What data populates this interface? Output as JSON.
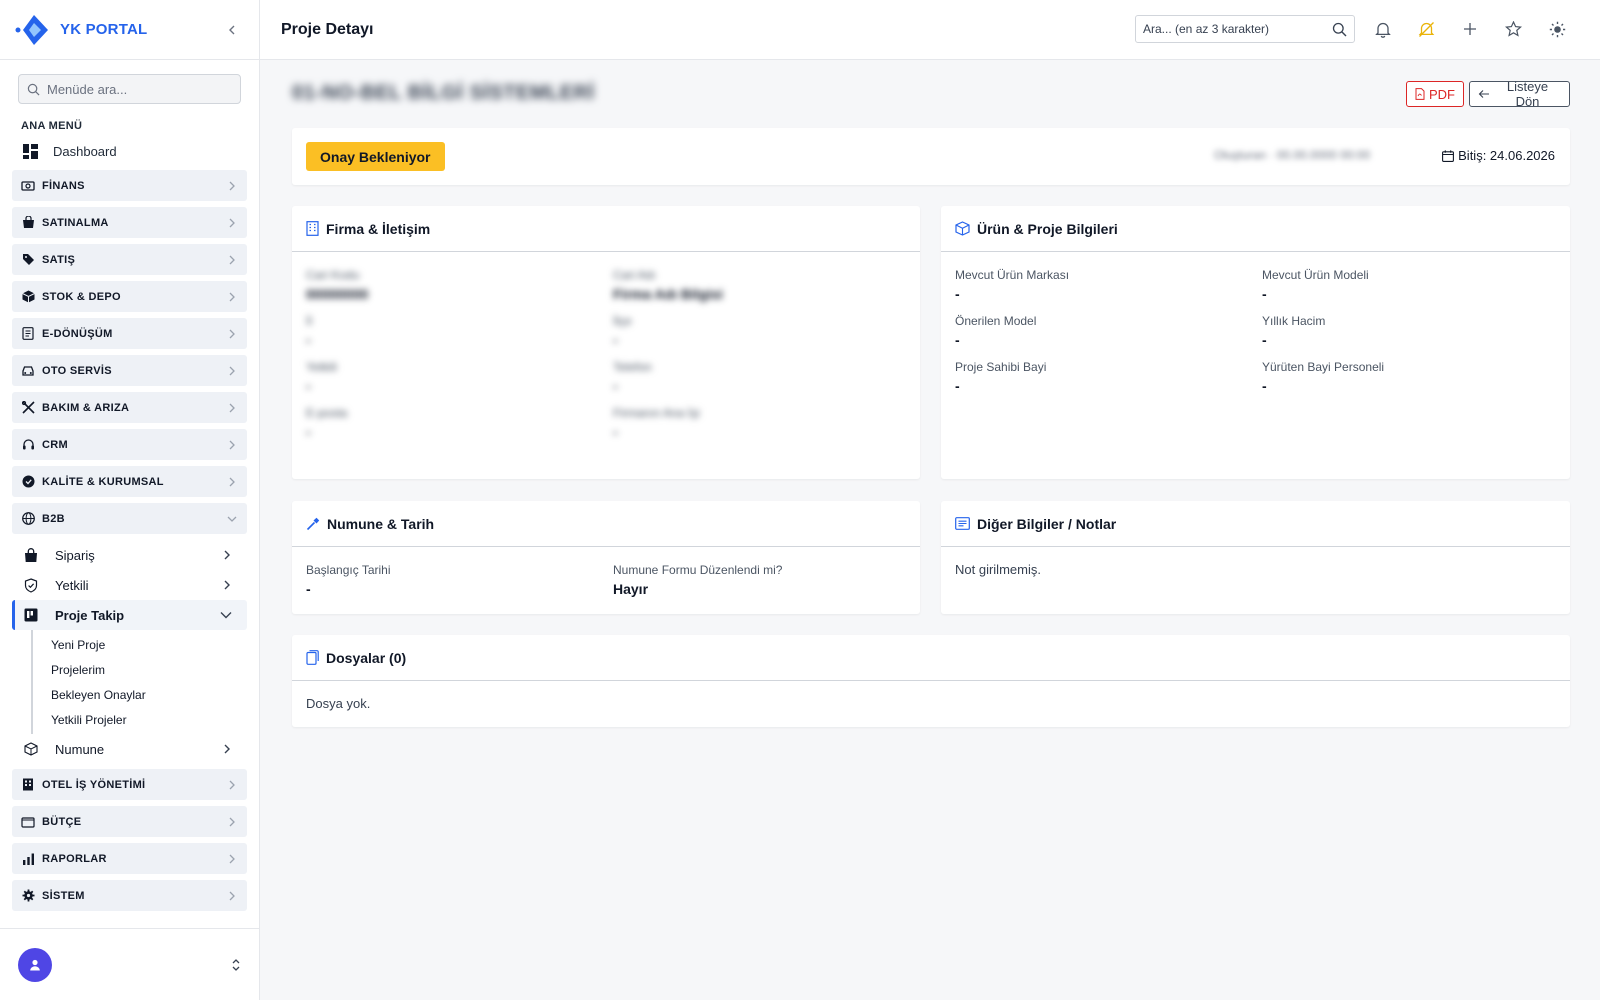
{
  "brand": {
    "name": "YK PORTAL"
  },
  "sidebar": {
    "search_placeholder": "Menüde ara...",
    "section_title": "ANA MENÜ",
    "dashboard_label": "Dashboard",
    "groups_top": [
      {
        "label": "FİNANS",
        "icon": "finance-icon"
      },
      {
        "label": "SATINALMA",
        "icon": "shopping-bag-icon"
      },
      {
        "label": "SATIŞ",
        "icon": "tag-icon"
      },
      {
        "label": "STOK & DEPO",
        "icon": "box-icon"
      },
      {
        "label": "E-DÖNÜŞÜM",
        "icon": "document-icon"
      },
      {
        "label": "OTO SERVİS",
        "icon": "car-icon"
      },
      {
        "label": "BAKIM & ARIZA",
        "icon": "tools-icon"
      },
      {
        "label": "CRM",
        "icon": "headset-icon"
      },
      {
        "label": "KALİTE & KURUMSAL",
        "icon": "badge-check-icon"
      },
      {
        "label": "B2B",
        "icon": "globe-icon"
      }
    ],
    "b2b_items": [
      {
        "label": "Sipariş",
        "icon": "bag-icon"
      },
      {
        "label": "Yetkili",
        "icon": "shield-icon"
      },
      {
        "label": "Proje Takip",
        "icon": "kanban-icon"
      }
    ],
    "proje_takip_items": [
      "Yeni Proje",
      "Projelerim",
      "Bekleyen Onaylar",
      "Yetkili Projeler"
    ],
    "numune_label": "Numune",
    "groups_bottom": [
      {
        "label": "OTEL İŞ YÖNETİMİ",
        "icon": "building-icon"
      },
      {
        "label": "BÜTÇE",
        "icon": "wallet-icon"
      },
      {
        "label": "RAPORLAR",
        "icon": "bar-chart-icon"
      },
      {
        "label": "SİSTEM",
        "icon": "gear-icon"
      }
    ]
  },
  "topbar": {
    "page_title": "Proje Detayı",
    "search_placeholder": "Ara... (en az 3 karakter)"
  },
  "header": {
    "project_title": "01-NO-BEL BİLGİ SİSTEMLERİ",
    "pdf_label": "PDF",
    "back_label": "Listeye Dön"
  },
  "status": {
    "badge": "Onay Bekleniyor",
    "meta": "Oluşturan · 00.00.0000 00:00",
    "end_date": "Bitiş: 24.06.2026"
  },
  "firma": {
    "title": "Firma & İletişim",
    "fields": [
      {
        "label": "Cari Kodu",
        "value": "00000000"
      },
      {
        "label": "Cari Adı",
        "value": "Firma Adı Bilgisi"
      },
      {
        "label": "İl",
        "value": "-"
      },
      {
        "label": "İlçe",
        "value": "-"
      },
      {
        "label": "Yetkili",
        "value": "-"
      },
      {
        "label": "Telefon",
        "value": "-"
      },
      {
        "label": "E-posta",
        "value": "-"
      },
      {
        "label": "Firmanın Ana İşi",
        "value": "-"
      }
    ]
  },
  "urun": {
    "title": "Ürün & Proje Bilgileri",
    "fields": [
      {
        "label": "Mevcut Ürün Markası",
        "value": "-"
      },
      {
        "label": "Mevcut Ürün Modeli",
        "value": "-"
      },
      {
        "label": "Önerilen Model",
        "value": "-"
      },
      {
        "label": "Yıllık Hacim",
        "value": "-"
      },
      {
        "label": "Proje Sahibi Bayi",
        "value": "-"
      },
      {
        "label": "Yürüten Bayi Personeli",
        "value": "-"
      }
    ]
  },
  "numune": {
    "title": "Numune & Tarih",
    "fields": [
      {
        "label": "Başlangıç Tarihi",
        "value": "-"
      },
      {
        "label": "Numune Formu Düzenlendi mi?",
        "value": "Hayır"
      }
    ]
  },
  "notlar": {
    "title": "Diğer Bilgiler / Notlar",
    "text": "Not girilmemiş."
  },
  "dosyalar": {
    "title": "Dosyalar (0)",
    "text": "Dosya yok."
  },
  "colors": {
    "accent": "#2563eb",
    "badge": "#fbbf24",
    "pdf": "#dc2626",
    "avatar": "#4f46e5"
  }
}
